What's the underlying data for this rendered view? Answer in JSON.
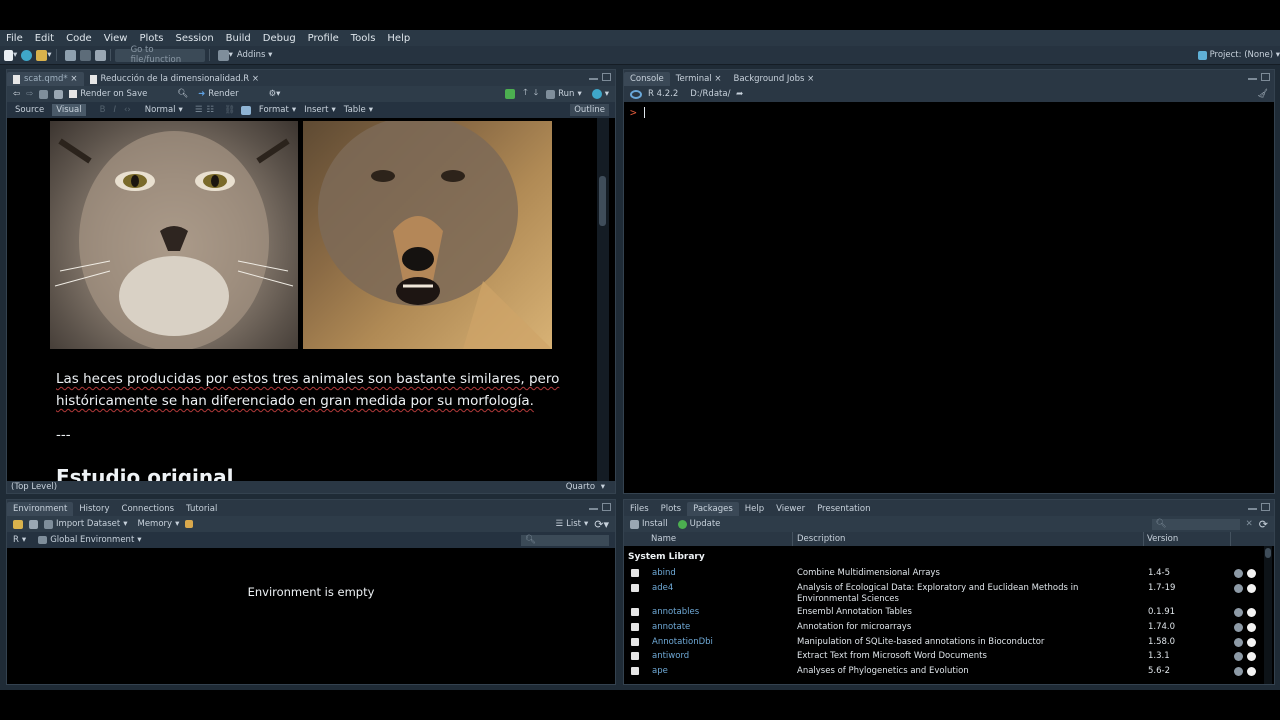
{
  "menu": [
    "File",
    "Edit",
    "Code",
    "View",
    "Plots",
    "Session",
    "Build",
    "Debug",
    "Profile",
    "Tools",
    "Help"
  ],
  "toolbar": {
    "goto_placeholder": "Go to file/function",
    "addins": "Addins",
    "project": "Project: (None)"
  },
  "editor": {
    "tabs": [
      "scat.qmd*",
      "Reducción de la dimensionalidad.R"
    ],
    "render_on_save": "Render on Save",
    "render": "Render",
    "run": "Run",
    "mode_source": "Source",
    "mode_visual": "Visual",
    "style_select": "Normal",
    "format": "Format",
    "insert": "Insert",
    "table": "Table",
    "outline": "Outline",
    "paragraph_line1": "Las heces producidas por estos tres animales son bastante similares, pero",
    "paragraph_line2": "históricamente se han diferenciado en gran medida por su morfología.",
    "rule": "---",
    "heading_partial": "Estudio original",
    "status_left": "(Top Level)",
    "status_right": "Quarto"
  },
  "console": {
    "tabs": [
      "Console",
      "Terminal",
      "Background Jobs"
    ],
    "r_version": "R 4.2.2",
    "path": "D:/Rdata/",
    "prompt": ">"
  },
  "environment": {
    "tabs": [
      "Environment",
      "History",
      "Connections",
      "Tutorial"
    ],
    "import_dataset": "Import Dataset",
    "memory": "Memory",
    "list": "List",
    "lang": "R",
    "scope": "Global Environment",
    "empty_message": "Environment is empty"
  },
  "packages": {
    "tabs": [
      "Files",
      "Plots",
      "Packages",
      "Help",
      "Viewer",
      "Presentation"
    ],
    "install": "Install",
    "update": "Update",
    "columns": {
      "name": "Name",
      "description": "Description",
      "version": "Version"
    },
    "section": "System Library",
    "rows": [
      {
        "name": "abind",
        "description": "Combine Multidimensional Arrays",
        "version": "1.4-5"
      },
      {
        "name": "ade4",
        "description": "Analysis of Ecological Data: Exploratory and Euclidean Methods in Environmental Sciences",
        "version": "1.7-19"
      },
      {
        "name": "annotables",
        "description": "Ensembl Annotation Tables",
        "version": "0.1.91"
      },
      {
        "name": "annotate",
        "description": "Annotation for microarrays",
        "version": "1.74.0"
      },
      {
        "name": "AnnotationDbi",
        "description": "Manipulation of SQLite-based annotations in Bioconductor",
        "version": "1.58.0"
      },
      {
        "name": "antiword",
        "description": "Extract Text from Microsoft Word Documents",
        "version": "1.3.1"
      },
      {
        "name": "ape",
        "description": "Analyses of Phylogenetics and Evolution",
        "version": "5.6-2"
      }
    ]
  }
}
